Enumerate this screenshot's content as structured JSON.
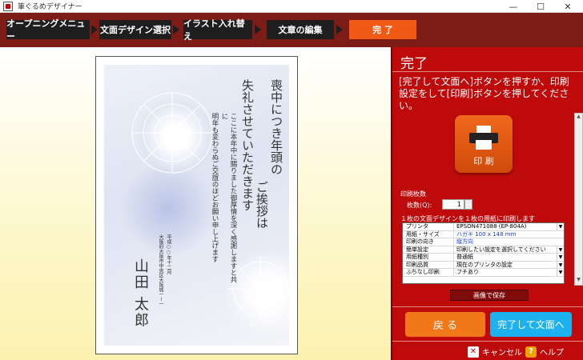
{
  "window": {
    "title": "筆ぐるめデザイナー",
    "minimize": "—",
    "maximize": "☐",
    "close": "✕"
  },
  "steps": [
    "オープニングメニュー",
    "文面デザイン選択",
    "イラスト入れ替え",
    "文章の編集",
    "完 了"
  ],
  "card": {
    "main_text": [
      "喪中につき年頭の",
      "ご挨拶は",
      "失礼させていただきます"
    ],
    "body_text": [
      "ここに本年中に賜りました御厚情を深く感謝しますと共に",
      "明年も変わらぬご交誼のほどお願い申し上げます"
    ],
    "date_text": "平成○○年十二月",
    "address": "大阪府大阪市中央区大阪城一ー一",
    "name": "山田 太郎"
  },
  "panel": {
    "title": "完了",
    "message": "[完了して文面へ]ボタンを押すか、印刷設定をして[印刷]ボタンを押してください。",
    "print_button": "印 刷",
    "copies_section": "印刷枚数",
    "copies_label": "枚数(Q):",
    "copies_value": "1",
    "layout_note": "１枚の文面デザインを１枚の用紙に印刷します",
    "settings": [
      {
        "label": "プリンタ",
        "value": "EPSON471088 (EP-804A)",
        "dropdown": true,
        "blue": false
      },
      {
        "label": "用紙・サイズ",
        "value": "ハガキ 100 x 148 mm",
        "dropdown": false,
        "blue": true
      },
      {
        "label": "印刷の向き",
        "value": "縦方向",
        "dropdown": false,
        "blue": true
      },
      {
        "label": "簡単設定",
        "value": "印刷したい設定を選択してください",
        "dropdown": true,
        "blue": false
      },
      {
        "label": "用紙種別",
        "value": "普通紙",
        "dropdown": true,
        "blue": false
      },
      {
        "label": "印刷品質",
        "value": "現在のプリンタの設定",
        "dropdown": true,
        "blue": false
      },
      {
        "label": "ふちなし印刷",
        "value": "フチあり",
        "dropdown": true,
        "blue": false
      }
    ],
    "save_button": "画像で保存",
    "back_button": "戻 る",
    "done_button": "完了して文面へ",
    "cancel_label": "キャンセル",
    "help_label": "ヘルプ"
  },
  "colors": {
    "step_bar": "#7d1b16",
    "active_step": "#f05a14",
    "panel": "#be0a0a",
    "back_button": "#f07818",
    "done_button": "#1db1f0"
  }
}
